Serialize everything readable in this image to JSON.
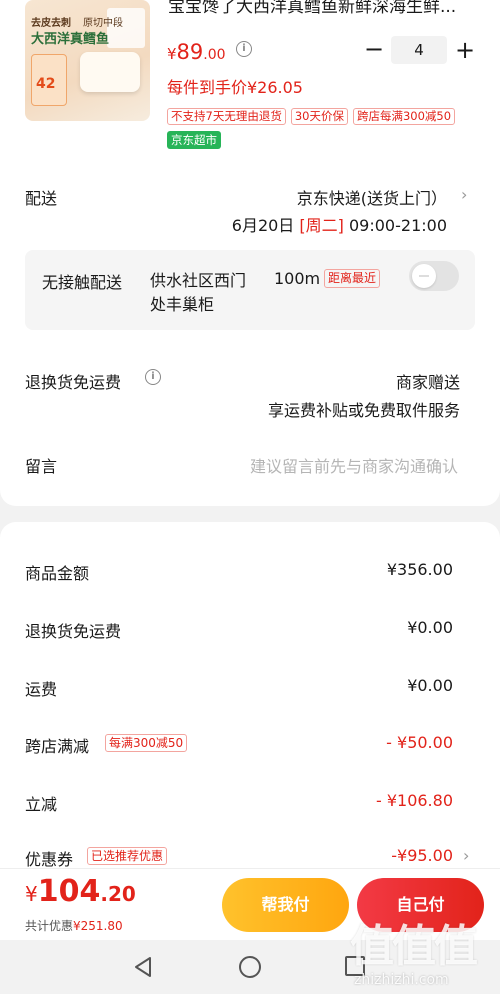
{
  "product": {
    "title": "宝宝馋了大西洋真鳕鱼新鲜深海生鲜...",
    "thumb_text_1": "去皮去刺",
    "thumb_text_2": "原切中段",
    "thumb_text_3": "大西洋真鳕鱼",
    "thumb_text_4": "42",
    "price_currency": "¥",
    "price_int": "89",
    "price_dec": ".00",
    "info_icon": "i",
    "qty_minus": "−",
    "quantity": "4",
    "qty_plus": "+",
    "unit_price": "每件到手价¥26.05",
    "tags": [
      "不支持7天无理由退货",
      "30天价保",
      "跨店每满300减50"
    ],
    "badge": "京东超市"
  },
  "delivery": {
    "label": "配送",
    "method": "京东快递(送货上门）",
    "date": "6月20日",
    "weekday": "[周二]",
    "time": "09:00-21:00"
  },
  "contactless": {
    "label": "无接触配送",
    "place": "供水社区西门处丰巢柜",
    "distance": "100m",
    "nearest_tag": "距离最近",
    "enabled": false
  },
  "returns": {
    "label": "退换货免运费",
    "value_1": "商家赠送",
    "value_2": "享运费补贴或免费取件服务"
  },
  "note": {
    "label": "留言",
    "placeholder": "建议留言前先与商家沟通确认"
  },
  "summary": {
    "goods_label": "商品金额",
    "goods_value": "¥356.00",
    "return_fee_label": "退换货免运费",
    "return_fee_value": "¥0.00",
    "shipping_label": "运费",
    "shipping_value": "¥0.00",
    "cross_store_label": "跨店满减",
    "cross_store_tag": "每满300减50",
    "cross_store_value": "- ¥50.00",
    "instant_label": "立减",
    "instant_value": "- ¥106.80",
    "coupon_label": "优惠券",
    "coupon_tag": "已选推荐优惠",
    "coupon_value": "-¥95.00"
  },
  "checkout": {
    "currency": "¥",
    "total_int": "104",
    "total_dec": ".20",
    "saved_label": "共计优惠",
    "saved_amount": "¥251.80",
    "help_pay": "帮我付",
    "self_pay": "自己付"
  },
  "watermark": {
    "logo": "值值值",
    "url": "zhizhizhi.com"
  },
  "colors": {
    "accent_red": "#e2231a",
    "jd_green": "#27b458",
    "help_orange": "#ffb31c"
  }
}
